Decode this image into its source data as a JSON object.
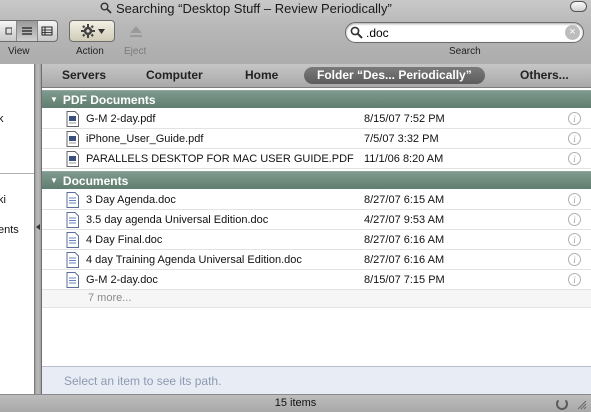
{
  "window": {
    "title": "Searching “Desktop Stuff – Review Periodically”"
  },
  "toolbar": {
    "view_label": "View",
    "action_label": "Action",
    "eject_label": "Eject",
    "search_label": "Search"
  },
  "search": {
    "value": ".doc",
    "clear_glyph": "×"
  },
  "sidebar": {
    "fragments": [
      "k",
      "ki",
      "ents"
    ]
  },
  "scope": {
    "items": [
      "Servers",
      "Computer",
      "Home",
      "Folder “Des... Periodically”",
      "Others..."
    ],
    "active_index": 3
  },
  "groups": [
    {
      "name": "PDF Documents",
      "icon": "pdf-file-icon",
      "rows": [
        {
          "name": "G-M 2-day.pdf",
          "date": "8/15/07 7:52 PM"
        },
        {
          "name": "iPhone_User_Guide.pdf",
          "date": "7/5/07 3:32 PM"
        },
        {
          "name": "PARALLELS DESKTOP FOR MAC USER GUIDE.PDF",
          "date": "11/1/06 8:20 AM"
        }
      ]
    },
    {
      "name": "Documents",
      "icon": "doc-file-icon",
      "rows": [
        {
          "name": "3 Day Agenda.doc",
          "date": "8/27/07 6:15 AM"
        },
        {
          "name": "3.5 day agenda Universal Edition.doc",
          "date": "4/27/07 9:53 AM"
        },
        {
          "name": "4 Day Final.doc",
          "date": "8/27/07 6:16 AM"
        },
        {
          "name": "4 day Training Agenda Universal Edition.doc",
          "date": "8/27/07 6:16 AM"
        },
        {
          "name": "G-M 2-day.doc",
          "date": "8/15/07 7:15 PM"
        }
      ],
      "more": "7 more..."
    }
  ],
  "path_bar": {
    "placeholder": "Select an item to see its path."
  },
  "status": {
    "count": "15 items"
  },
  "colors": {
    "group_header": "#6b877b",
    "scope_active": "#6a6a6a",
    "path_text": "#8e9ab0"
  }
}
